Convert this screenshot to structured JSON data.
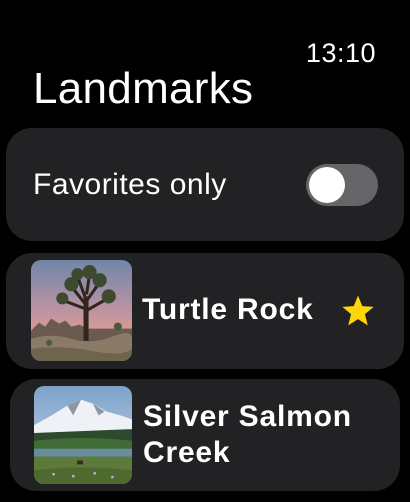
{
  "status": {
    "time": "13:10"
  },
  "header": {
    "title": "Landmarks"
  },
  "filter": {
    "label": "Favorites only",
    "enabled": false
  },
  "landmarks": [
    {
      "name": "Turtle Rock",
      "favorite": true,
      "image_icon": "turtle-rock-photo"
    },
    {
      "name": "Silver Salmon Creek",
      "favorite": false,
      "image_icon": "silver-salmon-creek-photo"
    }
  ],
  "colors": {
    "background": "#000000",
    "card": "#222224",
    "toggle_off": "#666669",
    "star": "#FFD60A"
  }
}
